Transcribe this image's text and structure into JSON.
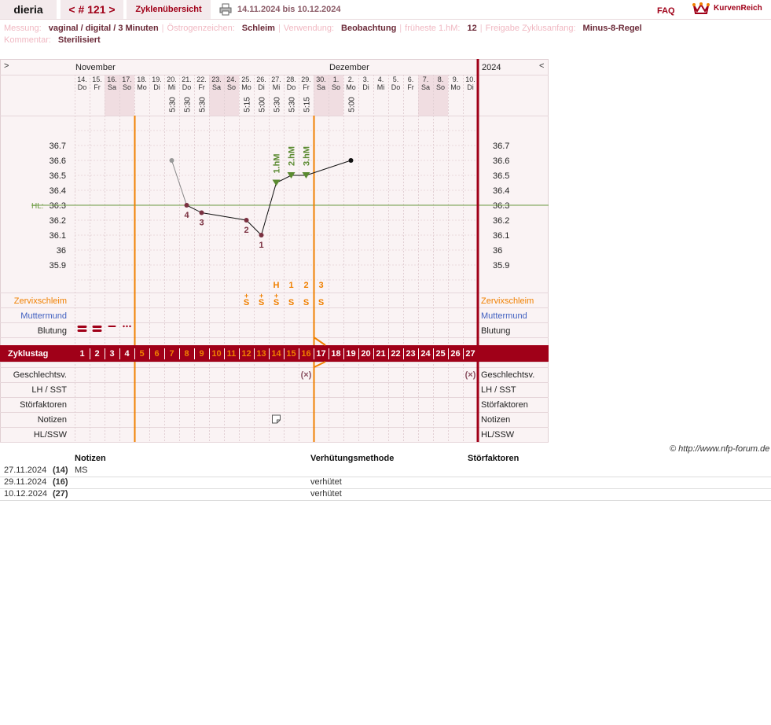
{
  "header": {
    "user": "dieria",
    "cycle_nav": "< # 121 >",
    "overview_tab": "Zyklenübersicht",
    "date_range": "14.11.2024 bis 10.12.2024",
    "faq": "FAQ",
    "brand": "KurvenReich"
  },
  "meta": {
    "line1": [
      {
        "k": "Messung:",
        "v": "vaginal / digital / 3 Minuten"
      },
      {
        "k": "Östrogenzeichen:",
        "v": "Schleim"
      },
      {
        "k": "Verwendung:",
        "v": "Beobachtung"
      },
      {
        "k": "früheste 1.hM:",
        "v": "12"
      },
      {
        "k": "Freigabe Zyklusanfang:",
        "v": "Minus-8-Regel"
      }
    ],
    "line2": [
      {
        "k": "Kommentar:",
        "v": "Sterilisiert"
      }
    ]
  },
  "chart": {
    "nav_left": ">",
    "nav_right": "<",
    "months": [
      "November",
      "Dezember"
    ],
    "year": "2024",
    "days": [
      {
        "d": "14.",
        "w": "Do",
        "time": ""
      },
      {
        "d": "15.",
        "w": "Fr",
        "time": ""
      },
      {
        "d": "16.",
        "w": "Sa",
        "time": "",
        "we": true
      },
      {
        "d": "17.",
        "w": "So",
        "time": "",
        "we": true
      },
      {
        "d": "18.",
        "w": "Mo",
        "time": ""
      },
      {
        "d": "19.",
        "w": "Di",
        "time": ""
      },
      {
        "d": "20.",
        "w": "Mi",
        "time": "5:30"
      },
      {
        "d": "21.",
        "w": "Do",
        "time": "5:30"
      },
      {
        "d": "22.",
        "w": "Fr",
        "time": "5:30"
      },
      {
        "d": "23.",
        "w": "Sa",
        "time": "",
        "we": true
      },
      {
        "d": "24.",
        "w": "So",
        "time": "",
        "we": true
      },
      {
        "d": "25.",
        "w": "Mo",
        "time": "5:15"
      },
      {
        "d": "26.",
        "w": "Di",
        "time": "5:00"
      },
      {
        "d": "27.",
        "w": "Mi",
        "time": "5:30"
      },
      {
        "d": "28.",
        "w": "Do",
        "time": "5:30"
      },
      {
        "d": "29.",
        "w": "Fr",
        "time": "5:15"
      },
      {
        "d": "30.",
        "w": "Sa",
        "time": "",
        "we": true
      },
      {
        "d": "1.",
        "w": "So",
        "time": "",
        "we": true
      },
      {
        "d": "2.",
        "w": "Mo",
        "time": "5:00"
      },
      {
        "d": "3.",
        "w": "Di",
        "time": ""
      },
      {
        "d": "4.",
        "w": "Mi",
        "time": ""
      },
      {
        "d": "5.",
        "w": "Do",
        "time": ""
      },
      {
        "d": "6.",
        "w": "Fr",
        "time": ""
      },
      {
        "d": "7.",
        "w": "Sa",
        "time": "",
        "we": true
      },
      {
        "d": "8.",
        "w": "So",
        "time": "",
        "we": true
      },
      {
        "d": "9.",
        "w": "Mo",
        "time": ""
      },
      {
        "d": "10.",
        "w": "Di",
        "time": ""
      }
    ],
    "y_ticks": [
      "36.7",
      "36.6",
      "36.5",
      "36.4",
      "36.3",
      "36.2",
      "36.1",
      "36",
      "35.9"
    ],
    "hl_label": "HL:",
    "hl_value": 36.3,
    "temps": [
      null,
      null,
      null,
      null,
      null,
      null,
      36.6,
      36.3,
      36.25,
      null,
      null,
      36.2,
      36.1,
      36.45,
      36.5,
      36.5,
      null,
      null,
      36.6,
      null,
      null,
      null,
      null,
      null,
      null,
      null,
      null
    ],
    "excluded_temps": [
      7
    ],
    "low_labels": [
      {
        "day": 8,
        "t": "4"
      },
      {
        "day": 9,
        "t": "3"
      },
      {
        "day": 12,
        "t": "2"
      },
      {
        "day": 13,
        "t": "1"
      }
    ],
    "high_labels": [
      {
        "day": 14,
        "t": "1.hM"
      },
      {
        "day": 15,
        "t": "2.hM"
      },
      {
        "day": 16,
        "t": "3.hM"
      }
    ],
    "mucus_peak": [
      {
        "day": 14,
        "t": "H"
      },
      {
        "day": 15,
        "t": "1"
      },
      {
        "day": 16,
        "t": "2"
      },
      {
        "day": 17,
        "t": "3"
      }
    ],
    "mucus": [
      {
        "day": 12,
        "t": "S",
        "plus": "+"
      },
      {
        "day": 13,
        "t": "S",
        "plus": "+"
      },
      {
        "day": 14,
        "t": "S",
        "plus": "+"
      },
      {
        "day": 15,
        "t": "S"
      },
      {
        "day": 16,
        "t": "S"
      },
      {
        "day": 17,
        "t": "S"
      }
    ],
    "rows": {
      "cervix": "Zervixschleim",
      "cervix_pos": "Muttermund",
      "bleeding": "Blutung",
      "cycle_day": "Zyklustag",
      "intercourse": "Geschlechtsv.",
      "lh": "LH / SST",
      "disturb": "Störfaktoren",
      "notes": "Notizen",
      "hlssw": "HL/SSW"
    },
    "cycle_days": [
      "1",
      "2",
      "3",
      "4",
      "5",
      "6",
      "7",
      "8",
      "9",
      "10",
      "11",
      "12",
      "13",
      "14",
      "15",
      "16",
      "17",
      "18",
      "19",
      "20",
      "21",
      "22",
      "23",
      "24",
      "25",
      "26",
      "27"
    ],
    "fertile_days": [
      5,
      17
    ],
    "intercourse_marks": [
      16,
      27
    ],
    "intercourse_symbol": "(×)",
    "note_marks": [
      14
    ],
    "colors": {
      "accent": "#a00018",
      "orange": "#f08000",
      "green": "#5a8a30",
      "temp_dark": "#7a3040",
      "hl": "#6a9a40"
    }
  },
  "copyright": "© http://www.nfp-forum.de",
  "notes_table": {
    "headers": {
      "notes": "Notizen",
      "method": "Verhütungsmethode",
      "disturb": "Störfaktoren"
    },
    "rows": [
      {
        "date": "27.11.2024",
        "day": "(14)",
        "note": "MS",
        "method": ""
      },
      {
        "date": "29.11.2024",
        "day": "(16)",
        "note": "",
        "method": "verhütet"
      },
      {
        "date": "10.12.2024",
        "day": "(27)",
        "note": "",
        "method": "verhütet"
      }
    ]
  }
}
